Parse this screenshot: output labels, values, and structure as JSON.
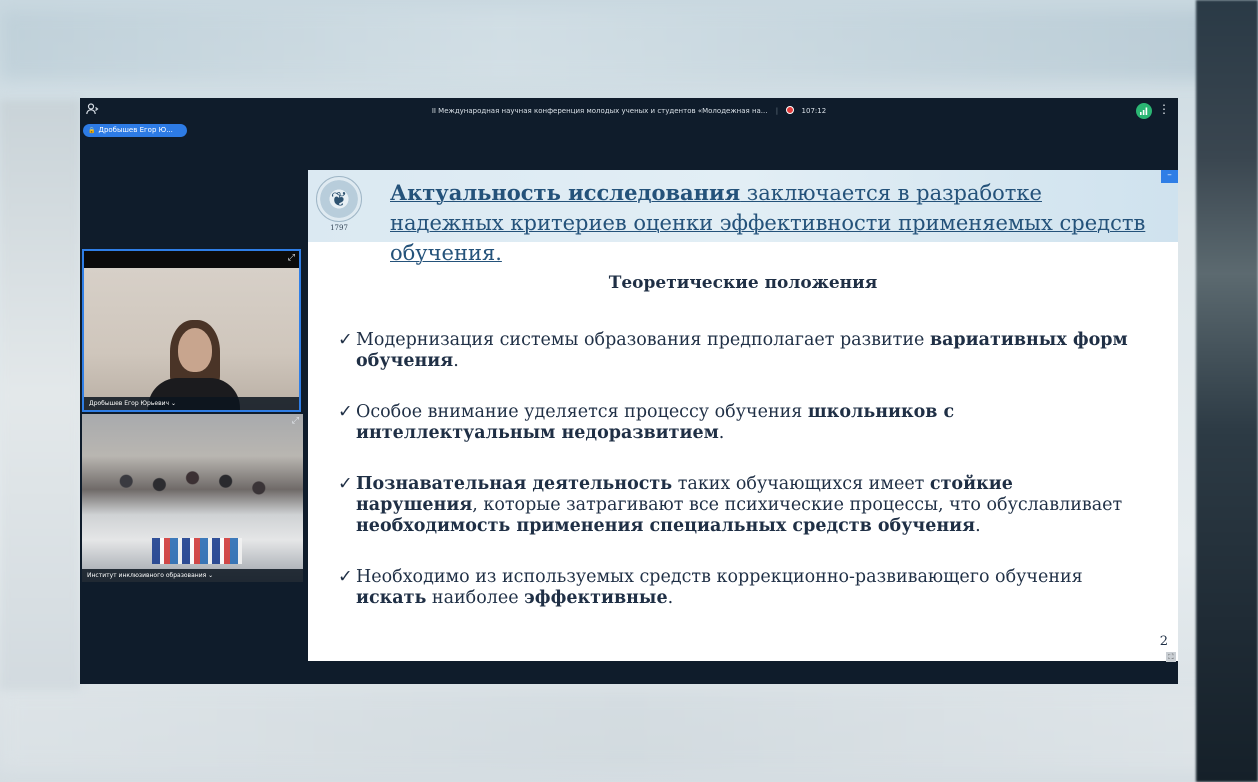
{
  "header": {
    "conference_title": "II Международная научная конференция молодых ученых и студентов «Молодежная на...",
    "recording_time": "107:12"
  },
  "speaker_pill": "Дробышев Егор Ю...",
  "tiles": [
    {
      "label": "Дробышев Егор Юрьевич ⌄"
    },
    {
      "label": "Институт инклюзивного образования ⌄"
    }
  ],
  "slide": {
    "header_bold": "Актуальность исследования",
    "header_rest": " заключается в разработке надежных критериев оценки эффективности применяемых средств обучения.",
    "logo_year": "1797",
    "subtitle": "Теоретические положения",
    "bullets": [
      {
        "parts": [
          {
            "t": "Модернизация системы образования предполагает развитие ",
            "b": false
          },
          {
            "t": "вариативных форм обучения",
            "b": true
          },
          {
            "t": ".",
            "b": false
          }
        ]
      },
      {
        "parts": [
          {
            "t": "Особое внимание уделяется процессу обучения ",
            "b": false
          },
          {
            "t": "школьников с интеллектуальным недоразвитием",
            "b": true
          },
          {
            "t": ".",
            "b": false
          }
        ]
      },
      {
        "parts": [
          {
            "t": "Познавательная деятельность",
            "b": true
          },
          {
            "t": " таких обучающихся имеет ",
            "b": false
          },
          {
            "t": "стойкие нарушения",
            "b": true
          },
          {
            "t": ", которые затрагивают все психические процессы, что обуславливает ",
            "b": false
          },
          {
            "t": "необходимость применения специальных средств обучения",
            "b": true
          },
          {
            "t": ".",
            "b": false
          }
        ]
      },
      {
        "parts": [
          {
            "t": "Необходимо из используемых средств коррекционно-развивающего обучения ",
            "b": false
          },
          {
            "t": "искать",
            "b": true
          },
          {
            "t": " наиболее ",
            "b": false
          },
          {
            "t": "эффективные",
            "b": true
          },
          {
            "t": ".",
            "b": false
          }
        ]
      }
    ],
    "page_number": "2"
  },
  "icons": {
    "participants": "person-plus-icon",
    "signal": "signal-icon",
    "more": "more-vertical-icon",
    "expand": "expand-icon",
    "record": "record-icon"
  },
  "colors": {
    "window_bg": "#0f1c2b",
    "accent": "#2f7ee6",
    "record": "#e23c3c",
    "signal": "#2bb673",
    "slide_title": "#24527a"
  }
}
